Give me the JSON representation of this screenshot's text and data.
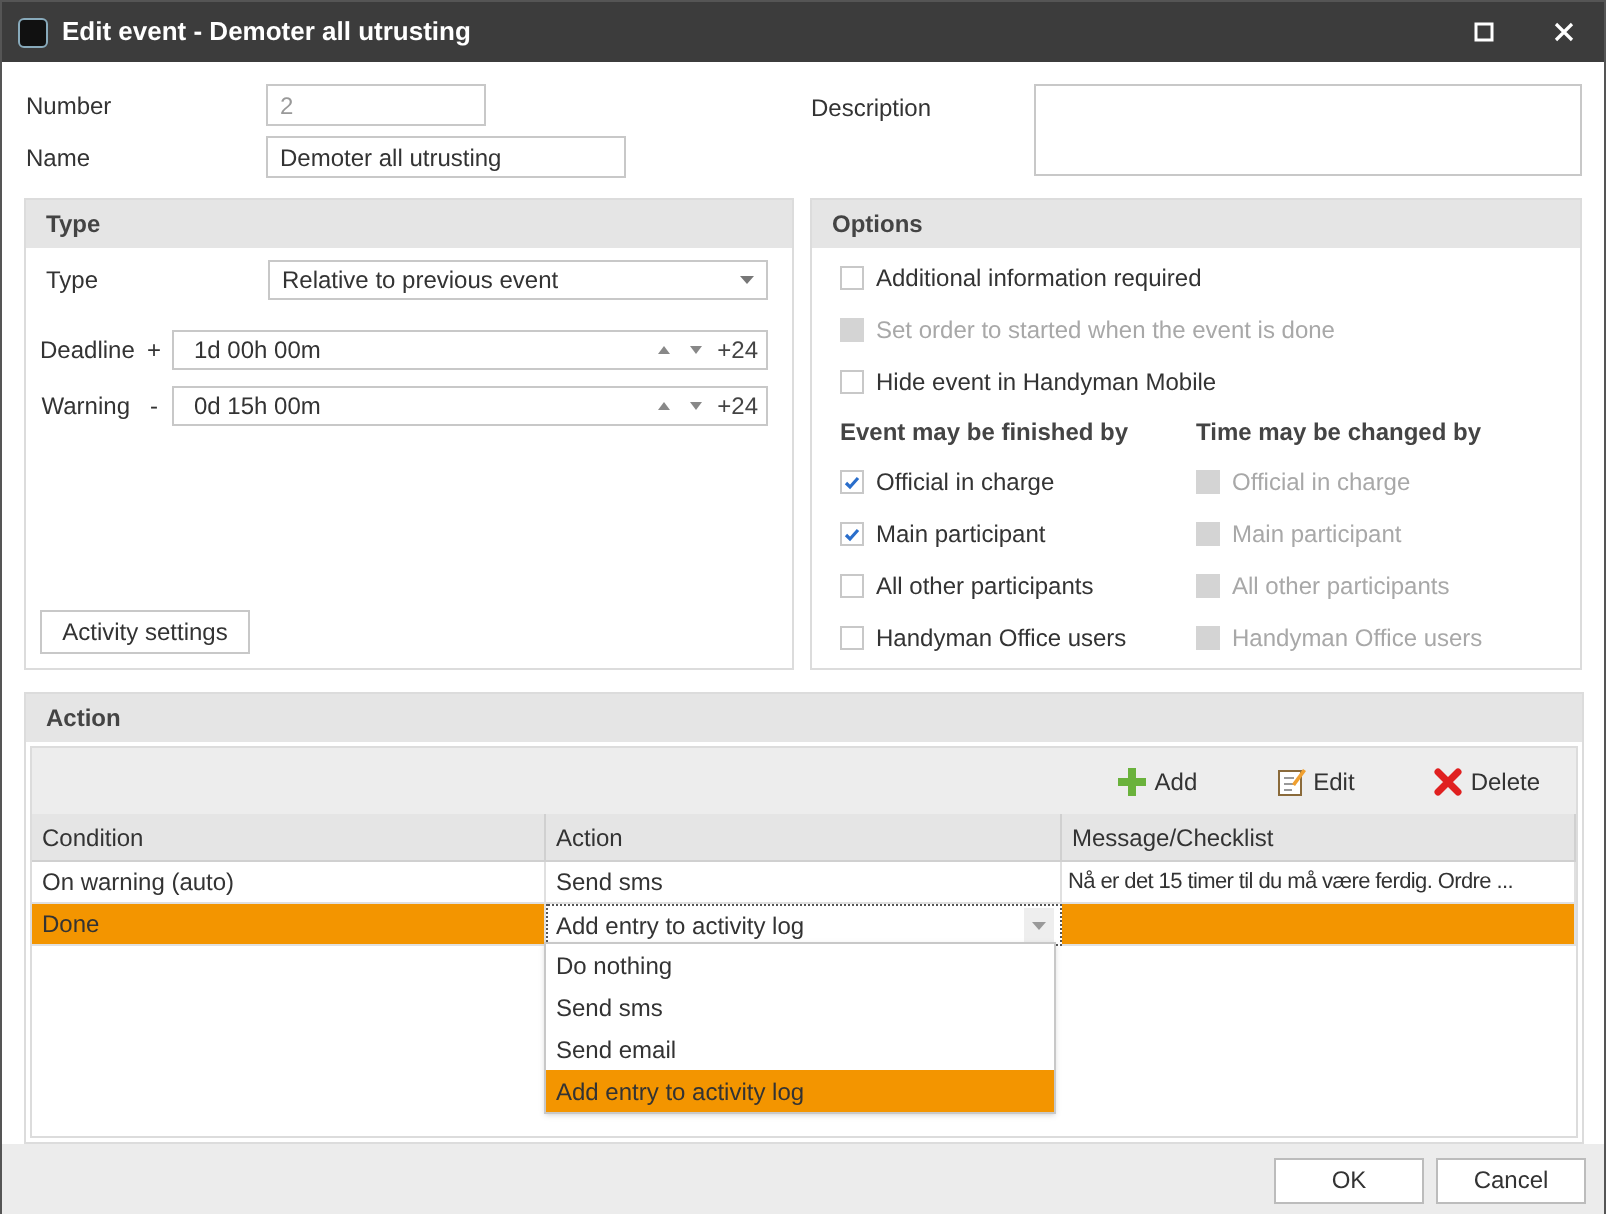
{
  "window": {
    "title": "Edit event - Demoter all utrusting"
  },
  "fields": {
    "number": {
      "label": "Number",
      "value": "2",
      "disabled": true
    },
    "name": {
      "label": "Name",
      "value": "Demoter all utrusting"
    },
    "description": {
      "label": "Description"
    }
  },
  "type_panel": {
    "title": "Type",
    "type_label": "Type",
    "type_value": "Relative to previous event",
    "times": [
      {
        "label": "Deadline",
        "sign": "+",
        "value": "1d 00h 00m",
        "offset": "+24"
      },
      {
        "label": "Warning",
        "sign": "-",
        "value": "0d 15h 00m",
        "offset": "+24"
      }
    ],
    "button": "Activity settings"
  },
  "options": {
    "title": "Options",
    "items": [
      {
        "label": "Additional information required",
        "checked": false,
        "disabled": false
      },
      {
        "label": "Set order to started when the event is done",
        "checked": false,
        "disabled": true
      },
      {
        "label": "Hide event in Handyman Mobile",
        "checked": false,
        "disabled": false
      }
    ],
    "groups": [
      {
        "title": "Event may be finished by",
        "items": [
          {
            "label": "Official in charge",
            "checked": true,
            "disabled": false
          },
          {
            "label": "Main participant",
            "checked": true,
            "disabled": false
          },
          {
            "label": "All other participants",
            "checked": false,
            "disabled": false
          },
          {
            "label": "Handyman Office users",
            "checked": false,
            "disabled": false
          }
        ]
      },
      {
        "title": "Time may be changed by",
        "items": [
          {
            "label": "Official in charge",
            "checked": false,
            "disabled": true
          },
          {
            "label": "Main participant",
            "checked": false,
            "disabled": true
          },
          {
            "label": "All other participants",
            "checked": false,
            "disabled": true
          },
          {
            "label": "Handyman Office users",
            "checked": false,
            "disabled": true
          }
        ]
      }
    ]
  },
  "action": {
    "title": "Action",
    "toolbar": [
      {
        "label": "Add",
        "kind": "add"
      },
      {
        "label": "Edit",
        "kind": "edit"
      },
      {
        "label": "Delete",
        "kind": "delete"
      }
    ],
    "columns": [
      "Condition",
      "Action",
      "Message/Checklist"
    ],
    "rows": [
      {
        "cells": [
          "On warning (auto)",
          "Send sms",
          "Nå er det 15 timer til du må være ferdig. Ordre  ..."
        ],
        "selected": false
      },
      {
        "cells": [
          "Done",
          "Add entry to activity log"
        ],
        "selected": true
      }
    ],
    "dropdown": [
      {
        "label": "Do nothing",
        "selected": false
      },
      {
        "label": "Send sms",
        "selected": false
      },
      {
        "label": "Send email",
        "selected": false
      },
      {
        "label": "Add entry to activity log",
        "selected": true
      }
    ]
  },
  "buttons": [
    "OK",
    "Cancel"
  ]
}
